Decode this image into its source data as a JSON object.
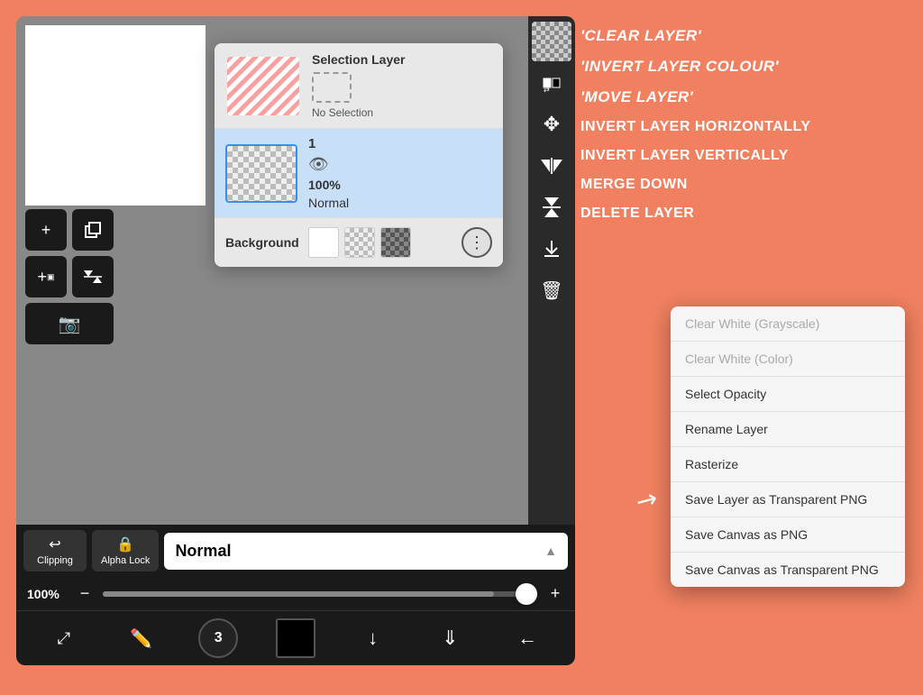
{
  "annotations": {
    "clear_layer": "'CLEAR LAYER'",
    "invert_colour": "'INVERT LAYER COLOUR'",
    "move_layer": "'MOVE LAYER'",
    "invert_horizontal": "INVERT LAYER HORIZONTALLY",
    "invert_vertical": "INVERT LAYER VERTICALLY",
    "merge_down": "MERGE DOWN",
    "delete_layer": "DELETE LAYER"
  },
  "layers": {
    "selection_layer_title": "Selection Layer",
    "no_selection": "No Selection",
    "layer_number": "1",
    "layer_opacity": "100%",
    "layer_blend": "Normal",
    "background_label": "Background"
  },
  "controls": {
    "clipping_label": "Clipping",
    "alpha_lock_label": "Alpha Lock",
    "blend_mode": "Normal",
    "opacity_pct": "100%"
  },
  "context_menu": {
    "items": [
      {
        "label": "Clear White (Grayscale)",
        "disabled": true
      },
      {
        "label": "Clear White (Color)",
        "disabled": true
      },
      {
        "label": "Select Opacity",
        "disabled": false
      },
      {
        "label": "Rename Layer",
        "disabled": false
      },
      {
        "label": "Rasterize",
        "disabled": false
      },
      {
        "label": "Save Layer as Transparent PNG",
        "disabled": false
      },
      {
        "label": "Save Canvas as PNG",
        "disabled": false
      },
      {
        "label": "Save Canvas as Transparent PNG",
        "disabled": false
      }
    ]
  },
  "toolbar_icons": {
    "checkerboard": "▩",
    "invert_color": "⇄",
    "move": "✥",
    "flip_h": "◀▶",
    "flip_v": "▲▼",
    "merge": "⬇",
    "delete": "🗑"
  },
  "bottom_toolbar": {
    "transform": "⤢",
    "brush": "✏",
    "stamp": "3",
    "square": "■",
    "down_arrow": "↓",
    "double_arrow": "⇓",
    "back_arrow": "←"
  }
}
